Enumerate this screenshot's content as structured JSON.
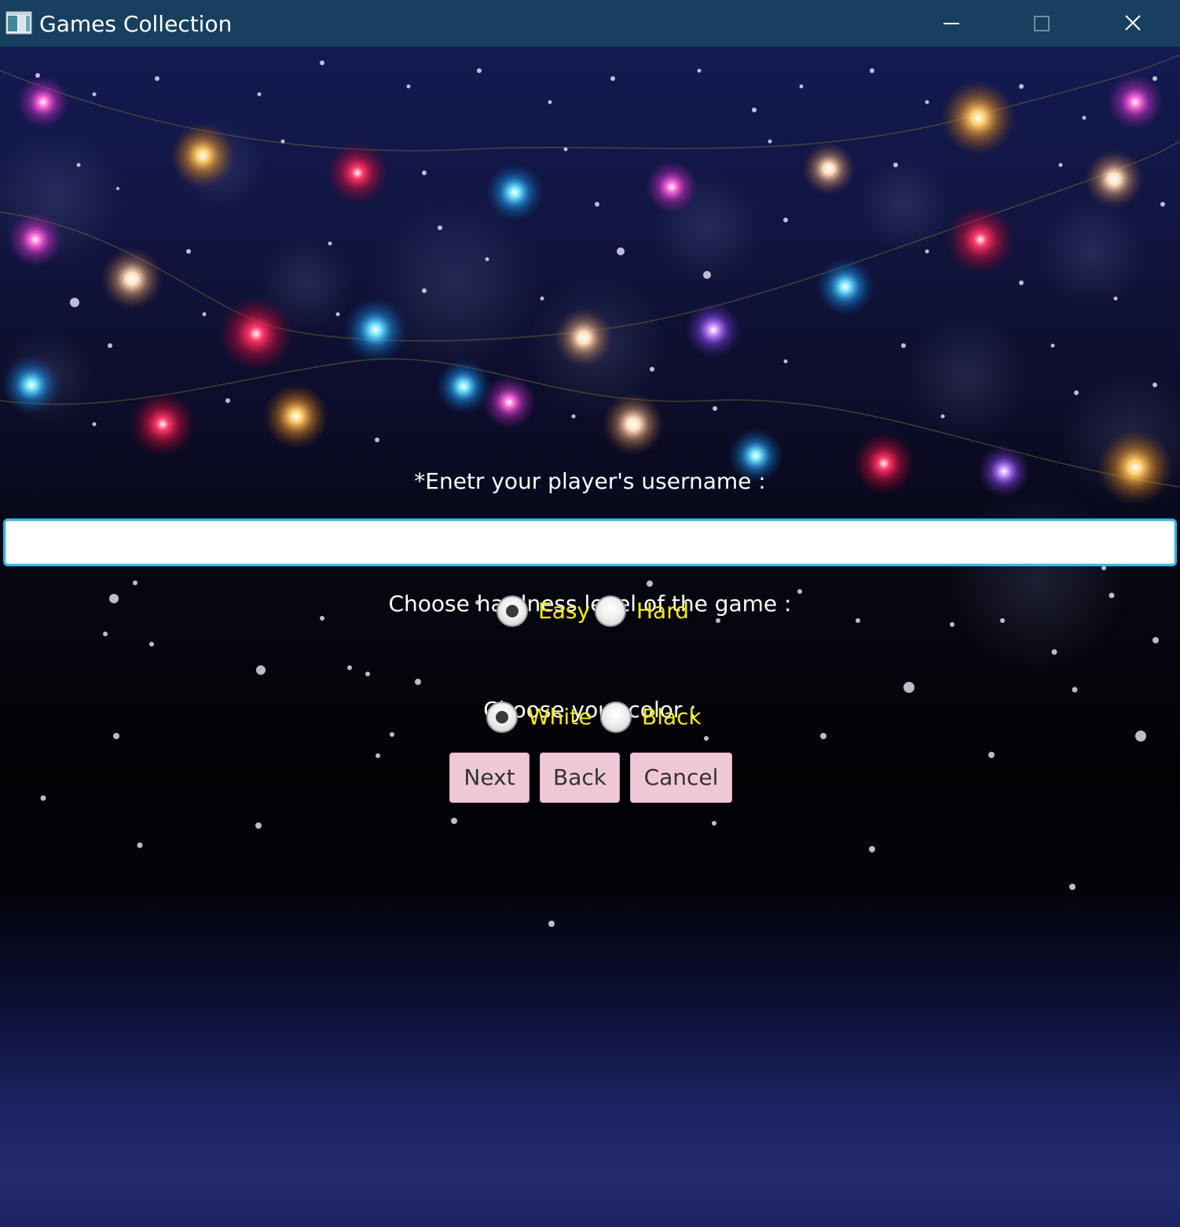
{
  "window": {
    "title": "Games Collection",
    "icon": "app-window-icon",
    "controls": {
      "minimize_icon": "minimize-icon",
      "maximize_icon": "maximize-icon",
      "close_icon": "close-icon"
    }
  },
  "form": {
    "username_label": "*Enetr your player's username :",
    "username_value": "",
    "hardness_label": "Choose hardness level of the game :",
    "hardness_options": [
      {
        "label": "Easy",
        "selected": true
      },
      {
        "label": "Hard",
        "selected": false
      }
    ],
    "color_label": "Choose your color :",
    "color_options": [
      {
        "label": "White",
        "selected": true
      },
      {
        "label": "Black",
        "selected": false
      }
    ],
    "buttons": {
      "next": "Next",
      "back": "Back",
      "cancel": "Cancel"
    }
  },
  "colors": {
    "titlebar": "#17405f",
    "option_text": "#f2ea10",
    "button_bg": "#efc8d8",
    "input_focus_border": "#35b4e3"
  }
}
